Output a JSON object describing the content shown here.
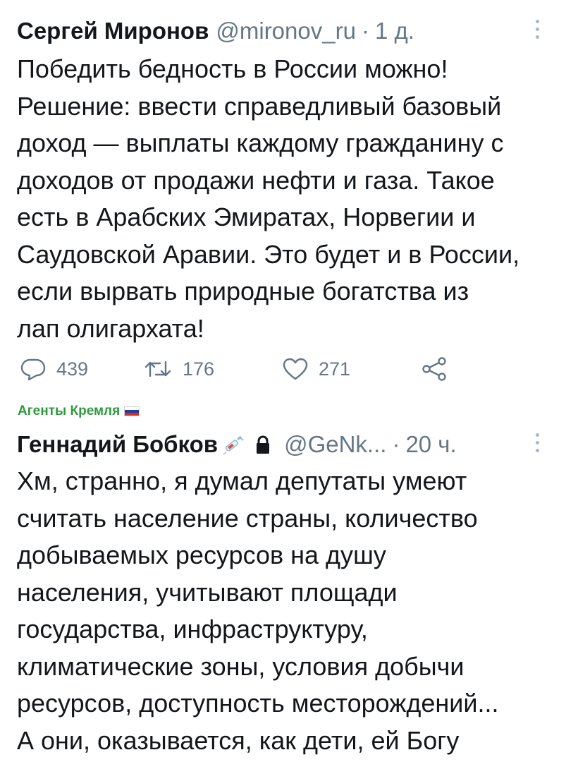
{
  "tweets": [
    {
      "author_name": "Сергей Миронов",
      "handle": "@mironov_ru",
      "time": "1 д.",
      "body_lines": [
        "Победить бедность в России можно!",
        "Решение: ввести справедливый базовый",
        "доход — выплаты каждому гражданину с",
        "доходов от продажи нефти и газа. Такое",
        "есть в Арабских Эмиратах, Норвегии и",
        "Саудовской Аравии. Это будет и в России,",
        "если вырвать природные богатства из",
        "лап олигархата!"
      ],
      "stats": {
        "replies": "439",
        "retweets": "176",
        "likes": "271"
      },
      "icons": {
        "reply": "reply-icon",
        "retweet": "retweet-icon",
        "like": "heart-icon",
        "share": "share-icon",
        "menu": "more-vertical-icon"
      }
    },
    {
      "context_label": "Агенты Кремля",
      "context_flag": "russia-flag-icon",
      "author_name": "Геннадий Бобков",
      "handle": "@GeNk...",
      "time": "20 ч.",
      "icons": {
        "name_emoji": "syringe-icon",
        "protected": "lock-icon",
        "menu": "more-vertical-icon"
      },
      "body_lines": [
        "Хм, странно, я думал депутаты умеют",
        "считать население страны, количество",
        "добываемых ресурсов на душу",
        "населения, учитывают площади",
        "государства, инфраструктуру,",
        "климатические зоны, условия добычи",
        "ресурсов, доступность месторождений...",
        "А они, оказывается, как дети, ей Богу"
      ]
    }
  ],
  "colors": {
    "text": "#14171a",
    "secondary": "#657786",
    "context_green": "#2e9b3e",
    "flag_white": "#ffffff",
    "flag_blue": "#1c3f9e",
    "flag_red": "#d52b1e"
  }
}
